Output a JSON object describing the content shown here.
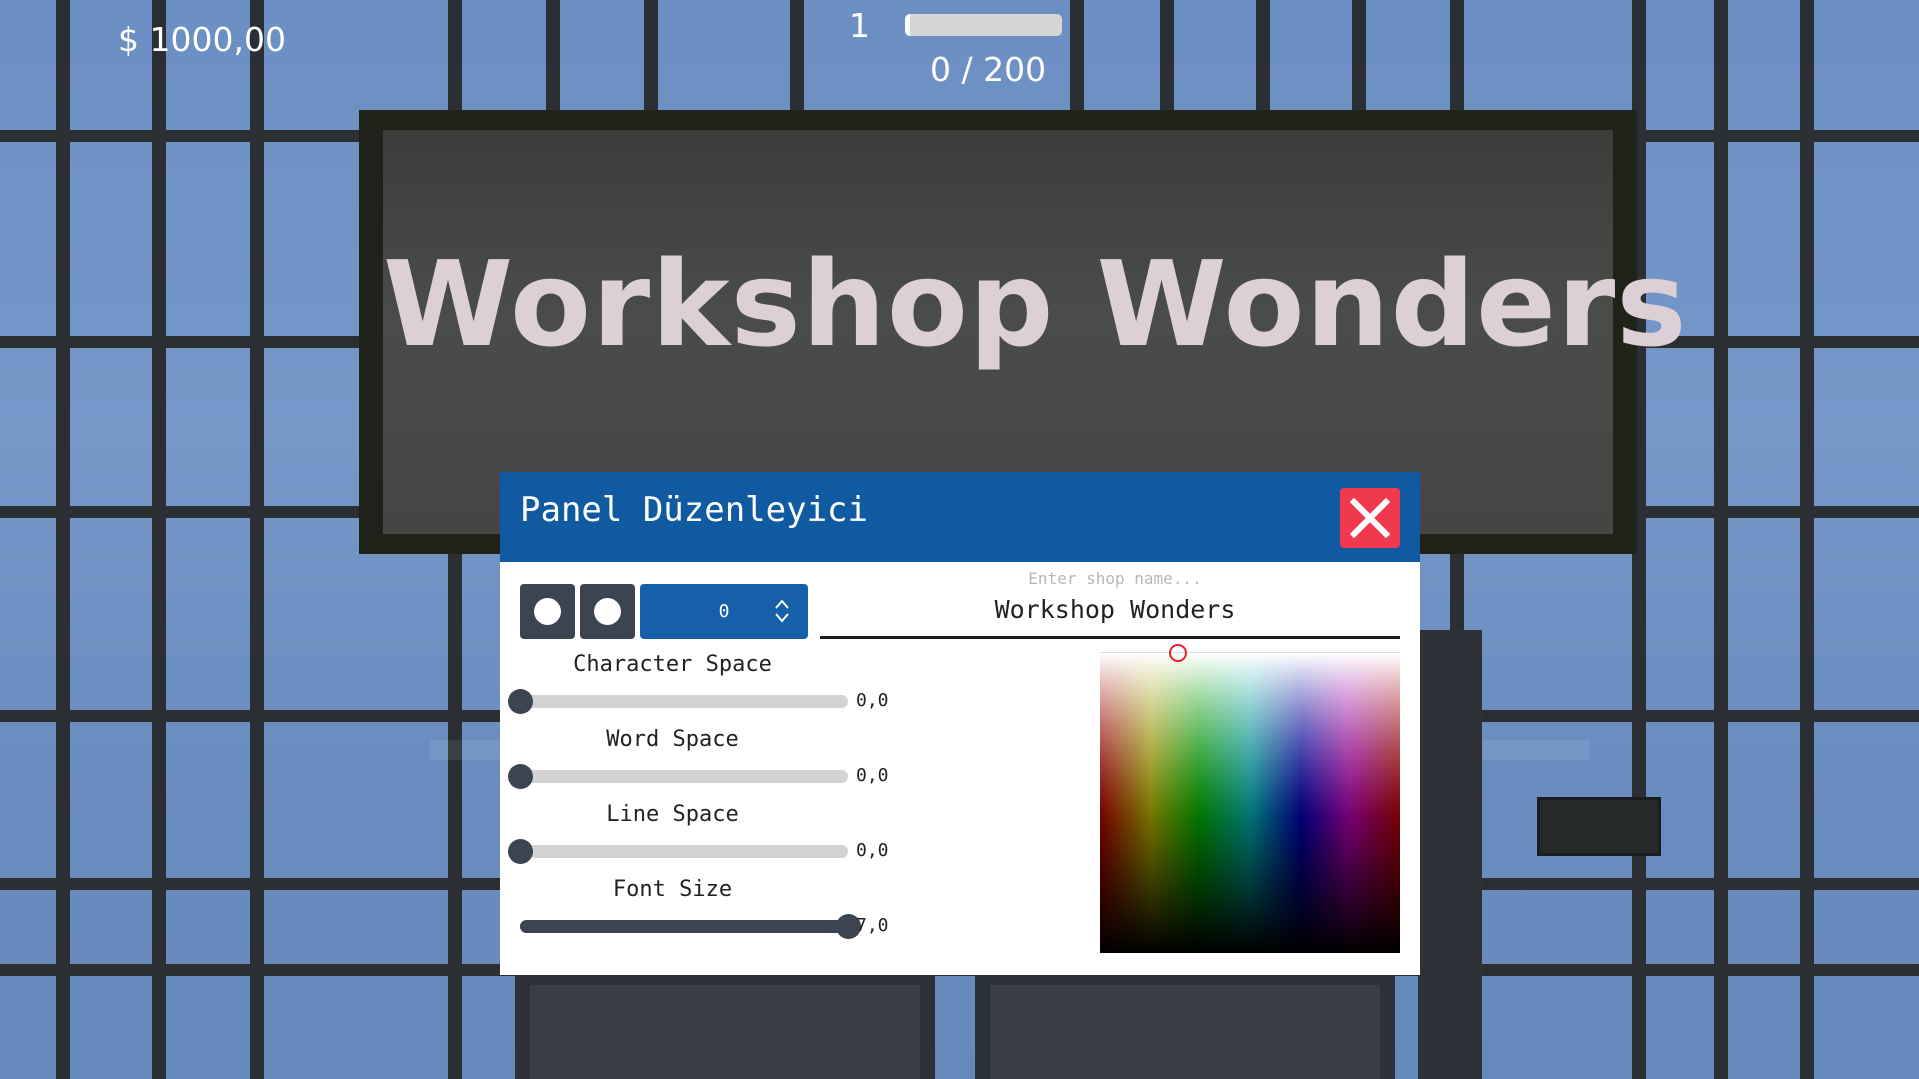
{
  "hud": {
    "money": "$ 1000,00",
    "level": "1",
    "xp": "0 / 200",
    "xp_progress": 0.03
  },
  "sign": {
    "text": "Workshop Wonders"
  },
  "panel": {
    "title": "Panel Düzenleyici",
    "stepper_value": "0",
    "name_placeholder": "Enter shop name...",
    "name_value": "Workshop Wonders",
    "sliders": [
      {
        "label": "Character Space",
        "value": "0,0",
        "fraction": 0.0
      },
      {
        "label": "Word Space",
        "value": "0,0",
        "fraction": 0.0
      },
      {
        "label": "Line Space",
        "value": "0,0",
        "fraction": 0.0
      },
      {
        "label": "Font Size",
        "value": "7,0",
        "fraction": 1.0
      }
    ],
    "picker_selection": {
      "hue_fraction": 0.26,
      "value_fraction": 0.0
    }
  },
  "colors": {
    "header": "#0f5aa0",
    "close": "#f0384e",
    "accent": "#1560a8",
    "knob": "#3b4450"
  },
  "icons": {
    "close": "close-icon",
    "stepper": "chevron-up-down-icon",
    "circle": "circle-icon"
  }
}
